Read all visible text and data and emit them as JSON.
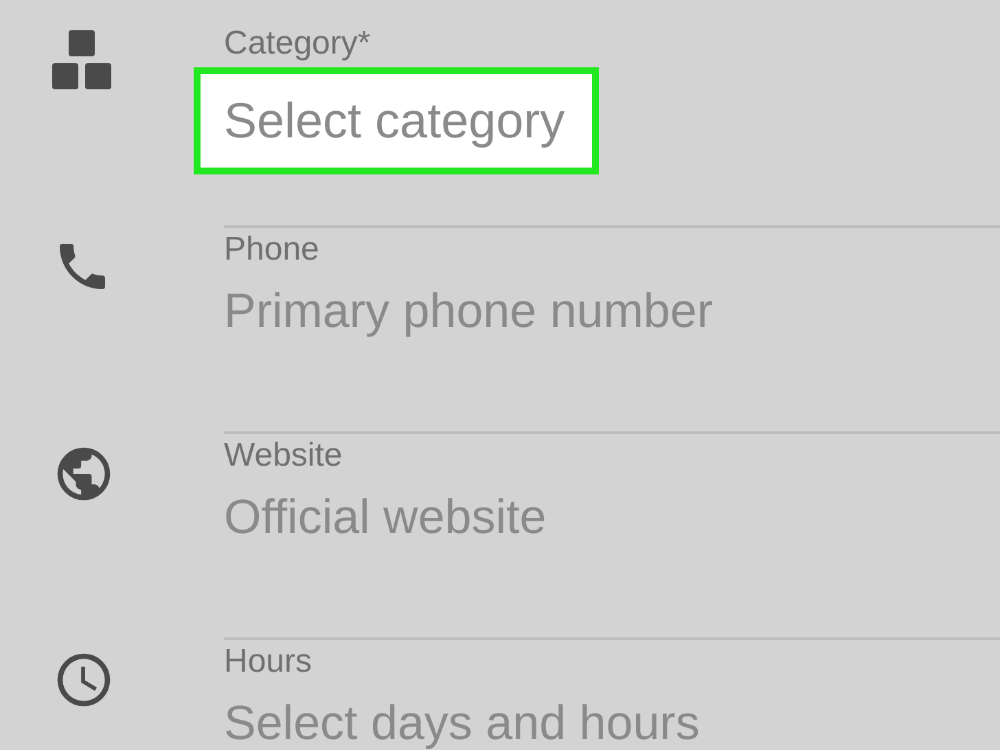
{
  "fields": [
    {
      "kind": "category",
      "label": "Category*",
      "placeholder": "Select category",
      "highlighted": true
    },
    {
      "kind": "phone",
      "label": "Phone",
      "placeholder": "Primary phone number",
      "highlighted": false
    },
    {
      "kind": "globe",
      "label": "Website",
      "placeholder": "Official website",
      "highlighted": false
    },
    {
      "kind": "clock",
      "label": "Hours",
      "placeholder": "Select days and hours",
      "highlighted": false
    }
  ]
}
